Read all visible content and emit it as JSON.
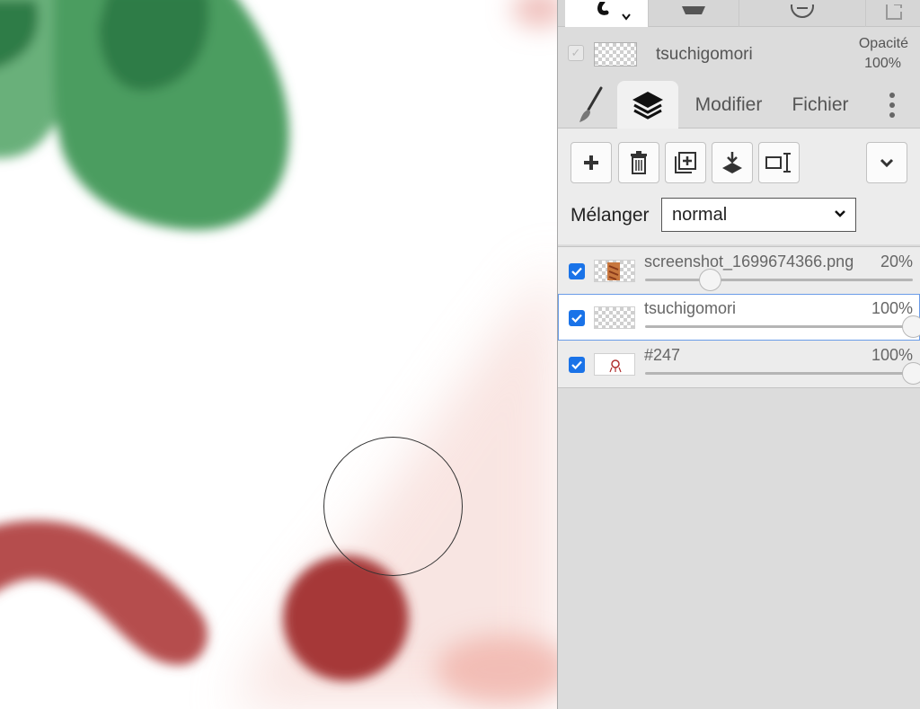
{
  "toolbar": {
    "tools": [
      {
        "icon": "brush-stroke-icon",
        "active": true
      },
      {
        "icon": "shape-icon",
        "active": false
      },
      {
        "icon": "minus-circle-icon",
        "active": false
      },
      {
        "icon": "export-icon",
        "active": false
      }
    ]
  },
  "current_layer": {
    "name": "tsuchigomori",
    "opacity_label": "Opacité",
    "opacity_value": "100%"
  },
  "tabs": [
    {
      "icon": "brush-icon",
      "label": "",
      "active": false
    },
    {
      "icon": "layers-icon",
      "label": "",
      "active": true
    },
    {
      "icon": "",
      "label": "Modifier",
      "active": false
    },
    {
      "icon": "",
      "label": "Fichier",
      "active": false
    },
    {
      "icon": "more-vertical-icon",
      "label": "",
      "active": false
    }
  ],
  "layer_actions": [
    "add-layer",
    "delete-layer",
    "duplicate-layer",
    "merge-down",
    "rename-layer",
    "more"
  ],
  "blend": {
    "label": "Mélanger",
    "value": "normal"
  },
  "layers": [
    {
      "name": "screenshot_1699674366.png",
      "opacity": "20%",
      "opacity_fraction": 0.2,
      "checked": true,
      "selected": false,
      "thumb": "image"
    },
    {
      "name": "tsuchigomori",
      "opacity": "100%",
      "opacity_fraction": 1.0,
      "checked": true,
      "selected": true,
      "thumb": "transparent"
    },
    {
      "name": "#247",
      "opacity": "100%",
      "opacity_fraction": 1.0,
      "checked": true,
      "selected": false,
      "thumb": "sketch"
    }
  ],
  "colors": {
    "accent": "#1a73e8",
    "green_paint": "#3e9256",
    "red_paint": "#a83c3c",
    "pink_wash": "#f2c4bf"
  }
}
